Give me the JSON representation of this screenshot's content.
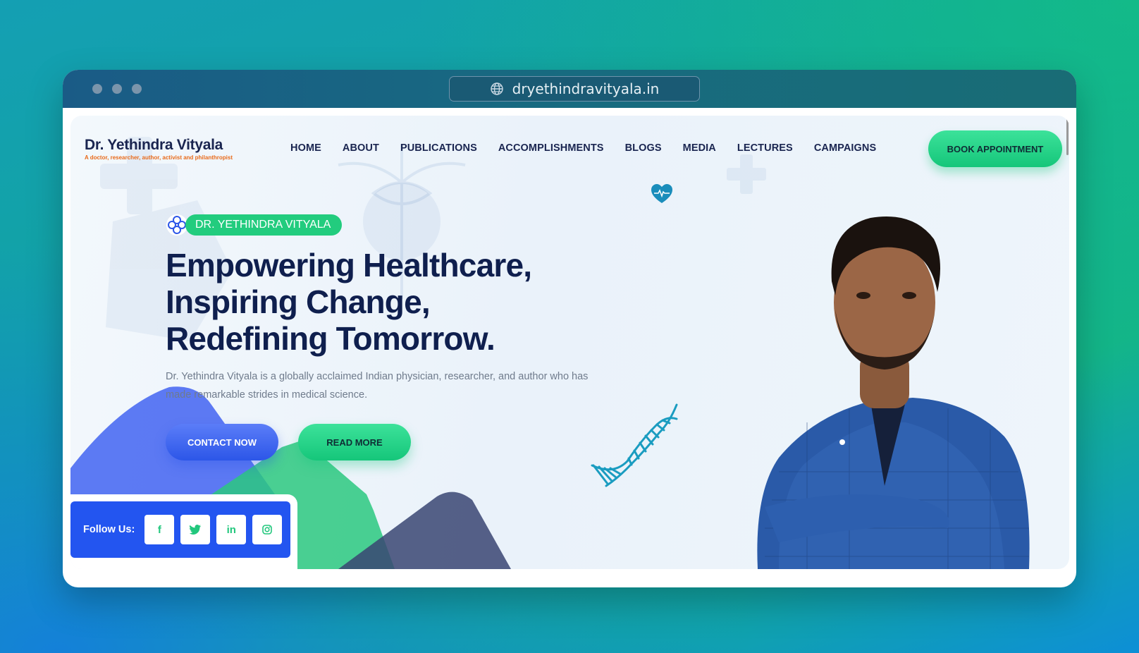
{
  "browser": {
    "url": "dryethindravityala.in"
  },
  "header": {
    "logo_name": "Dr. Yethindra Vityala",
    "logo_tagline": "A doctor, researcher, author, activist and philanthropist",
    "nav": [
      "HOME",
      "ABOUT",
      "PUBLICATIONS",
      "ACCOMPLISHMENTS",
      "BLOGS",
      "MEDIA",
      "LECTURES",
      "CAMPAIGNS"
    ],
    "cta_label": "BOOK APPOINTMENT"
  },
  "hero": {
    "badge": "DR. YETHINDRA VITYALA",
    "title_lines": [
      "Empowering Healthcare,",
      "Inspiring Change,",
      "Redefining Tomorrow."
    ],
    "description": "Dr. Yethindra Vityala is a globally acclaimed Indian physician, researcher, and author who has made remarkable strides in medical science.",
    "primary_button": "CONTACT NOW",
    "secondary_button": "READ MORE"
  },
  "social": {
    "label": "Follow Us:",
    "icons": [
      "facebook-icon",
      "twitter-icon",
      "linkedin-icon",
      "instagram-icon"
    ]
  },
  "colors": {
    "brand_navy": "#0f1f4e",
    "accent_green": "#22cc7e",
    "accent_blue": "#2355f0",
    "tagline_orange": "#e86a1a"
  }
}
